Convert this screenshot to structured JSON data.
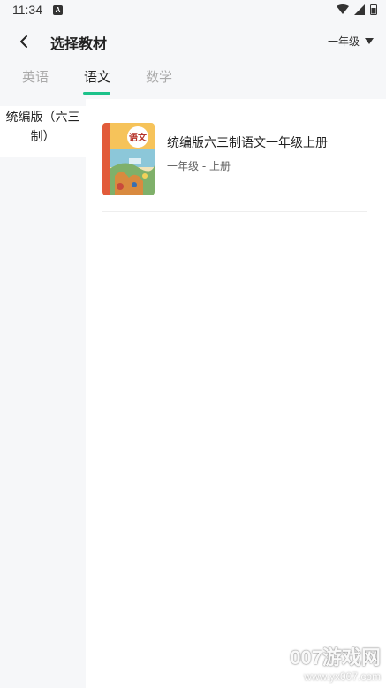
{
  "status_bar": {
    "time": "11:34",
    "notification_letter": "A",
    "icons": [
      "wifi-icon",
      "signal-icon",
      "battery-icon"
    ]
  },
  "header": {
    "title": "选择教材",
    "grade_select": "一年级"
  },
  "tabs": [
    {
      "label": "英语",
      "active": false
    },
    {
      "label": "语文",
      "active": true
    },
    {
      "label": "数学",
      "active": false
    }
  ],
  "sidebar": {
    "items": [
      {
        "label": "统编版（六三制）",
        "selected": true
      }
    ]
  },
  "books": [
    {
      "title": "统编版六三制语文一年级上册",
      "subtitle": "一年级 - 上册",
      "cover_text": "语文"
    }
  ],
  "watermark": {
    "logo": "007游戏网",
    "url": "www.yx007.com"
  },
  "colors": {
    "accent": "#1cc28a",
    "background": "#f6f7f9"
  }
}
